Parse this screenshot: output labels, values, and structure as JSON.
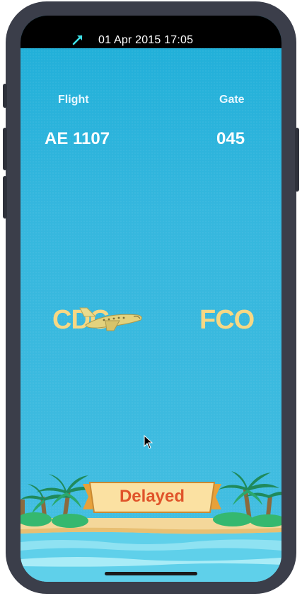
{
  "status_bar": {
    "datetime": "01 Apr 2015 17:05",
    "icon": "location-arrow-icon"
  },
  "flight_info": {
    "flight_label": "Flight",
    "flight_number": "AE 1107",
    "gate_label": "Gate",
    "gate_number": "045"
  },
  "route": {
    "origin": "CDG",
    "destination": "FCO",
    "icon": "airplane-icon"
  },
  "status": {
    "text": "Delayed"
  },
  "colors": {
    "sky": "#35b7de",
    "airport_code": "#f7d884",
    "status_text": "#e0542a",
    "banner": "#fbe1a2",
    "frame": "#3b3e4a"
  }
}
